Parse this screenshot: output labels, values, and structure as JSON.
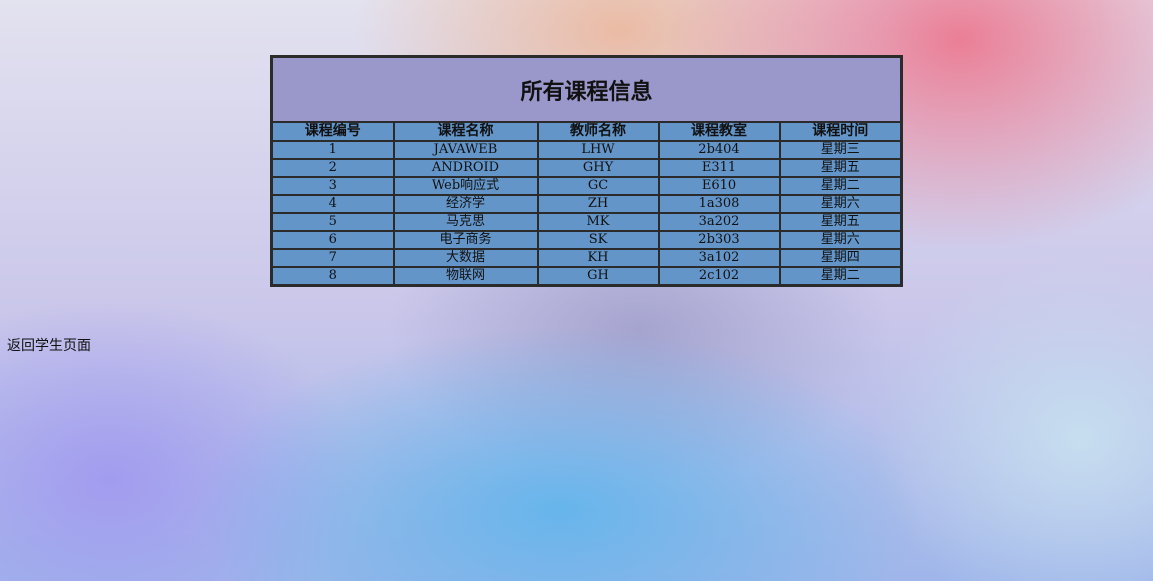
{
  "table": {
    "title": "所有课程信息",
    "headers": [
      "课程编号",
      "课程名称",
      "教师名称",
      "课程教室",
      "课程时间"
    ],
    "rows": [
      [
        "1",
        "JAVAWEB",
        "LHW",
        "2b404",
        "星期三"
      ],
      [
        "2",
        "ANDROID",
        "GHY",
        "E311",
        "星期五"
      ],
      [
        "3",
        "Web响应式",
        "GC",
        "E610",
        "星期二"
      ],
      [
        "4",
        "经济学",
        "ZH",
        "1a308",
        "星期六"
      ],
      [
        "5",
        "马克思",
        "MK",
        "3a202",
        "星期五"
      ],
      [
        "6",
        "电子商务",
        "SK",
        "2b303",
        "星期六"
      ],
      [
        "7",
        "大数据",
        "KH",
        "3a102",
        "星期四"
      ],
      [
        "8",
        "物联网",
        "GH",
        "2c102",
        "星期二"
      ]
    ]
  },
  "back_link": {
    "label": "返回学生页面"
  },
  "colors": {
    "title_bg": "#9a98cb",
    "cell_bg": "#6395c9",
    "border": "#2b2b2b"
  }
}
